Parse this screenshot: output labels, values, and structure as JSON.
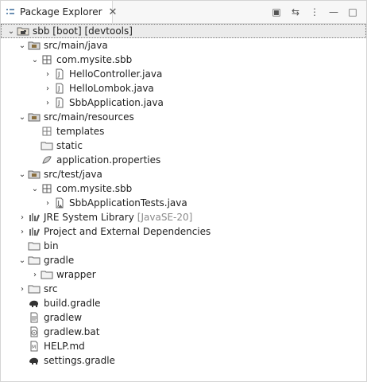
{
  "view": {
    "tab_title": "Package Explorer",
    "tab_close": "✕",
    "toolbar": {
      "collapse_all": "▣",
      "link_with_editor": "⇆",
      "view_menu": "⋮",
      "minimize": "—",
      "maximize": "□"
    }
  },
  "tree": {
    "project": "sbb [boot] [devtools]",
    "src_main_java": "src/main/java",
    "pkg_main": "com.mysite.sbb",
    "file_1": "HelloController.java",
    "file_2": "HelloLombok.java",
    "file_3": "SbbApplication.java",
    "src_main_resources": "src/main/resources",
    "templates": "templates",
    "static": "static",
    "application_properties": "application.properties",
    "src_test_java": "src/test/java",
    "pkg_test": "com.mysite.sbb",
    "test_file": "SbbApplicationTests.java",
    "jre_label": "JRE System Library",
    "jre_decor": "[JavaSE-20]",
    "deps": "Project and External Dependencies",
    "bin": "bin",
    "gradle": "gradle",
    "wrapper": "wrapper",
    "src": "src",
    "build_gradle": "build.gradle",
    "gradlew": "gradlew",
    "gradlew_bat": "gradlew.bat",
    "help_md": "HELP.md",
    "settings_gradle": "settings.gradle"
  },
  "twisty": {
    "expanded": "⌄",
    "collapsed": "›"
  },
  "icons": {
    "tab": "package-explorer-icon",
    "project": "gradle-project-icon",
    "source_folder": "source-folder-icon",
    "package": "package-icon",
    "java_file": "java-file-icon",
    "folder": "folder-icon",
    "properties_file": "properties-file-icon",
    "library": "library-icon",
    "gradle_file": "gradle-elephant-icon",
    "text_file": "text-file-icon",
    "bat_file": "bat-file-icon",
    "md_file": "markdown-file-icon"
  }
}
